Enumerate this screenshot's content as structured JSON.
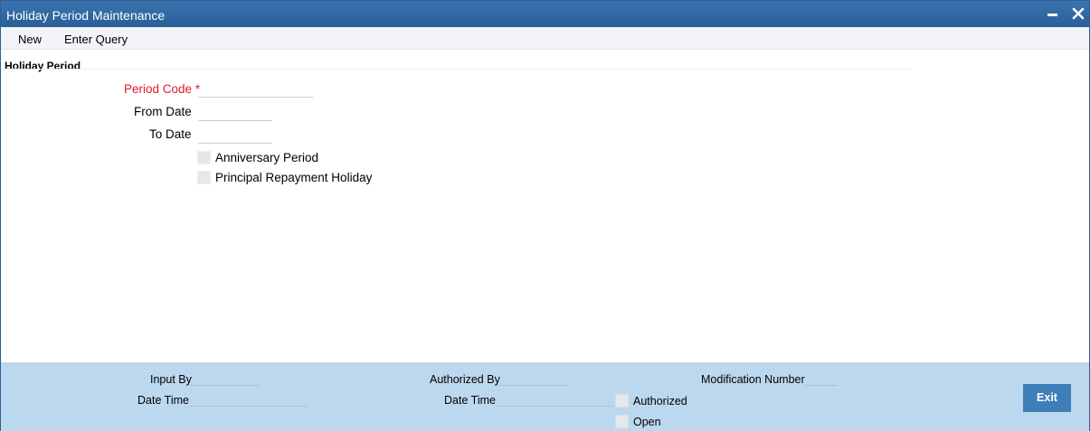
{
  "window": {
    "title": "Holiday Period Maintenance"
  },
  "toolbar": {
    "new_label": "New",
    "enter_query_label": "Enter Query"
  },
  "section": {
    "title": "Holiday Period"
  },
  "form": {
    "period_code": {
      "label": "Period Code",
      "required_mark": "*",
      "value": ""
    },
    "from_date": {
      "label": "From Date",
      "value": ""
    },
    "to_date": {
      "label": "To Date",
      "value": ""
    },
    "anniversary_period": {
      "label": "Anniversary Period",
      "checked": false
    },
    "principal_repayment_holiday": {
      "label": "Principal Repayment Holiday",
      "checked": false
    }
  },
  "footer": {
    "input_by_label": "Input By",
    "input_date_time_label": "Date Time",
    "authorized_by_label": "Authorized By",
    "auth_date_time_label": "Date Time",
    "modification_number_label": "Modification Number",
    "authorized_label": "Authorized",
    "open_label": "Open",
    "exit_label": "Exit"
  },
  "icons": {
    "minimize": "minimize-icon",
    "close": "close-icon"
  }
}
